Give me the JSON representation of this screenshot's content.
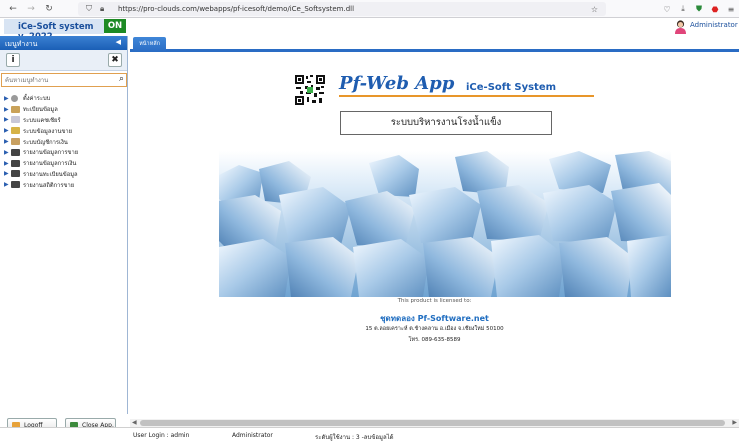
{
  "browser": {
    "url": "https://pro-clouds.com/webapps/pf-icesoft/demo/iCe_Softsystem.dll"
  },
  "header": {
    "app_title": "iCe-Soft system v. 2022",
    "status_badge": "ON",
    "user_name": "Administrator"
  },
  "sidebar": {
    "title": "เมนูทำงาน",
    "search_placeholder": "ค้นหาเมนูทำงาน",
    "items": [
      {
        "label": "ตั้งค่าระบบ",
        "color": "#9a9a9a"
      },
      {
        "label": "ทะเบียนข้อมูล",
        "color": "#c9a25a"
      },
      {
        "label": "ระบบแคชเชียร์",
        "color": "#c8c8d8"
      },
      {
        "label": "ระบบข้อมูลงานขาย",
        "color": "#d6b347"
      },
      {
        "label": "ระบบบัญชีการเงิน",
        "color": "#c8a060"
      },
      {
        "label": "รายงานข้อมูลการขาย",
        "color": "#444444"
      },
      {
        "label": "รายงานข้อมูลการเงิน",
        "color": "#444444"
      },
      {
        "label": "รายงานทะเบียนข้อมูล",
        "color": "#444444"
      },
      {
        "label": "รายงานสถิติการขาย",
        "color": "#444444"
      }
    ],
    "logoff_label": "Logoff",
    "close_label": "Close App."
  },
  "tab": {
    "label": "หน้าหลัก"
  },
  "main": {
    "logo_text": "Pf-Web App",
    "logo_subtitle": "iCe-Soft System",
    "system_name": "ระบบบริหารงานโรงน้ำแข็ง",
    "licensed_text": "This product is licensed to:",
    "company": "ชุดทดลอง Pf-Software.net",
    "address": "15 ต.ลอยเคราะห์ ต.ช้างคลาน อ.เมือง จ.เชียงใหม่ 50100",
    "phone": "โทร. 089-635-8589"
  },
  "status": {
    "user_login": "User Login :  admin",
    "role": "Administrator",
    "level": "ระดับผู้ใช้งาน :   3 -ลบข้อมูลได้"
  },
  "colors": {
    "brand_blue": "#1f5db0",
    "on_green": "#1d8a24",
    "accent_orange": "#e8962a"
  }
}
